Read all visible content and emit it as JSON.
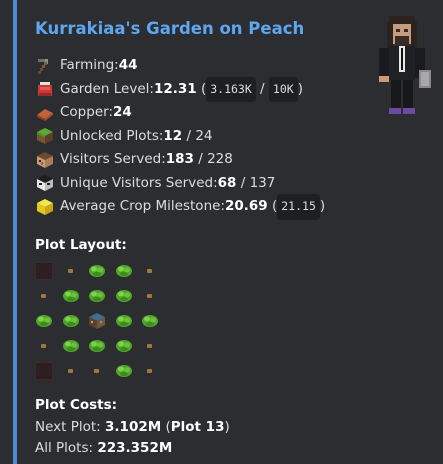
{
  "embed": {
    "title": "Kurrakiaa's Garden on Peach",
    "accent_color": "#4a8dd6"
  },
  "stats": [
    {
      "icon": "hoe-icon",
      "label": "Farming: ",
      "value": "44",
      "suffix": ""
    },
    {
      "icon": "garden-sack-icon",
      "label": "Garden Level: ",
      "value": "12.31",
      "progress_current": "3.163K",
      "progress_total": "10K"
    },
    {
      "icon": "copper-icon",
      "label": "Copper: ",
      "value": "24"
    },
    {
      "icon": "grass-block-icon",
      "label": "Unlocked Plots: ",
      "value": "12",
      "total": "24"
    },
    {
      "icon": "villager-head-icon",
      "label": "Visitors Served: ",
      "value": "183",
      "total": "228"
    },
    {
      "icon": "unique-visitor-head-icon",
      "label": "Unique Visitors Served: ",
      "value": "68",
      "total": "137"
    },
    {
      "icon": "milestone-block-icon",
      "label": "Average Crop Milestone: ",
      "value": "20.69",
      "extra": "21.15"
    }
  ],
  "plot_layout": {
    "title": "Plot Layout:",
    "rows": [
      [
        "locked",
        "seed",
        "crop",
        "crop",
        "seed"
      ],
      [
        "seed",
        "crop",
        "crop",
        "crop",
        "seed"
      ],
      [
        "crop",
        "crop",
        "barn",
        "crop",
        "crop"
      ],
      [
        "seed",
        "crop",
        "crop",
        "crop",
        "seed"
      ],
      [
        "locked",
        "seed",
        "seed",
        "crop",
        "seed"
      ]
    ]
  },
  "plot_costs": {
    "title": "Plot Costs:",
    "next_label": "Next Plot: ",
    "next_value": "3.102M",
    "next_plot": "Plot 13",
    "all_label": "All Plots: ",
    "all_value": "223.352M"
  }
}
